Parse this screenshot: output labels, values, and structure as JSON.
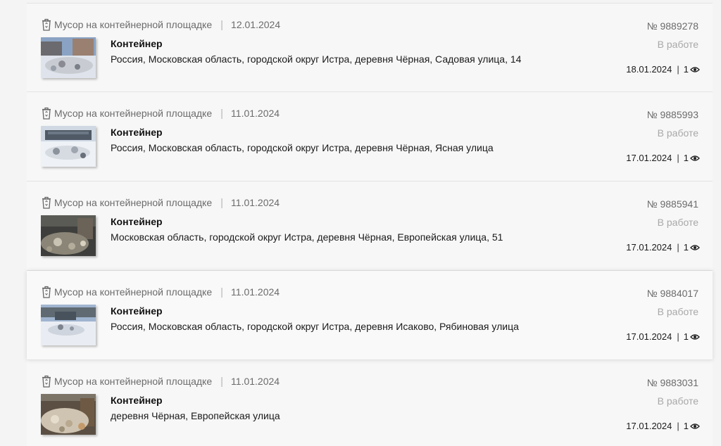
{
  "items": [
    {
      "category": "Мусор на контейнерной площадке",
      "date": "12.01.2024",
      "title": "Контейнер",
      "address": "Россия, Московская область, городской округ Истра, деревня Чёрная, Садовая улица, 14",
      "number": "№ 9889278",
      "status": "В работе",
      "updated": "18.01.2024",
      "views": "1"
    },
    {
      "category": "Мусор на контейнерной площадке",
      "date": "11.01.2024",
      "title": "Контейнер",
      "address": "Россия, Московская область, городской округ Истра, деревня Чёрная, Ясная улица",
      "number": "№ 9885993",
      "status": "В работе",
      "updated": "17.01.2024",
      "views": "1"
    },
    {
      "category": "Мусор на контейнерной площадке",
      "date": "11.01.2024",
      "title": "Контейнер",
      "address": "Московская область, городской округ Истра, деревня Чёрная, Европейская улица, 51",
      "number": "№ 9885941",
      "status": "В работе",
      "updated": "17.01.2024",
      "views": "1"
    },
    {
      "category": "Мусор на контейнерной площадке",
      "date": "11.01.2024",
      "title": "Контейнер",
      "address": "Россия, Московская область, городской округ Истра, деревня Исаково, Рябиновая улица",
      "number": "№ 9884017",
      "status": "В работе",
      "updated": "17.01.2024",
      "views": "1"
    },
    {
      "category": "Мусор на контейнерной площадке",
      "date": "11.01.2024",
      "title": "Контейнер",
      "address": "деревня Чёрная, Европейская улица",
      "number": "№ 9883031",
      "status": "В работе",
      "updated": "17.01.2024",
      "views": "1"
    }
  ],
  "icons": {
    "category": "trash-bin-icon",
    "views": "eye-icon"
  },
  "colors": {
    "status": "#a8a8a8",
    "muted": "#6b6b6b",
    "text": "#1a1a1a"
  }
}
